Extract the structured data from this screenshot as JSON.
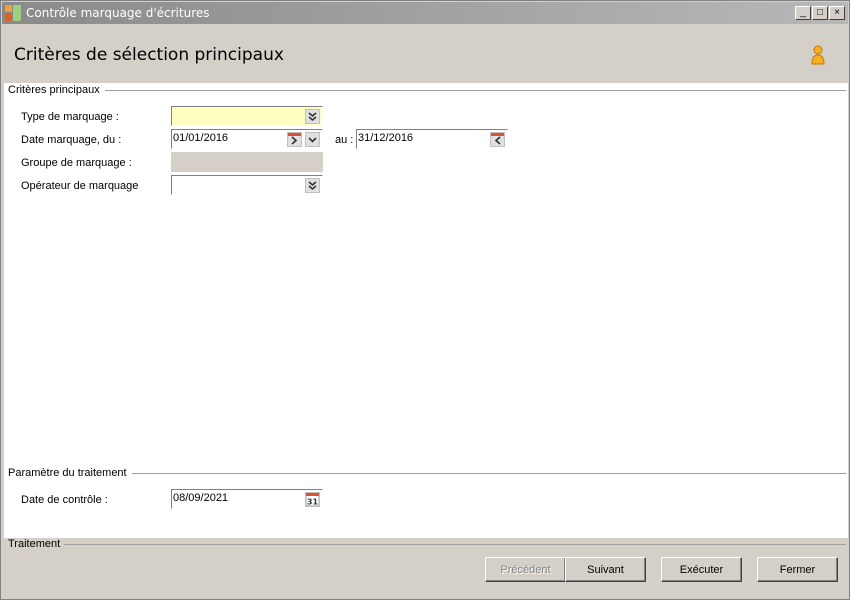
{
  "window": {
    "title": "Contrôle marquage d'écritures",
    "controls": {
      "minimize": "_",
      "maximize": "□",
      "close": "×"
    }
  },
  "header": {
    "title": "Critères de sélection principaux",
    "user_icon": "user-icon"
  },
  "criteria": {
    "section_label": "Critères principaux",
    "type_marquage": {
      "label": "Type de marquage :",
      "value": ""
    },
    "date_marquage": {
      "label": "Date marquage, du :",
      "from": "01/01/2016",
      "to_label": "au :",
      "to": "31/12/2016"
    },
    "groupe_marquage": {
      "label": "Groupe de marquage :",
      "value": ""
    },
    "operateur_marquage": {
      "label": "Opérateur de marquage",
      "value": ""
    }
  },
  "parametres": {
    "section_label": "Paramètre du traitement",
    "date_controle": {
      "label": "Date de contrôle :",
      "value": "08/09/2021"
    }
  },
  "traitement": {
    "section_label": "Traitement",
    "buttons": {
      "precedent": "Précédent",
      "suivant": "Suivant",
      "executer": "Exécuter",
      "fermer": "Fermer"
    }
  },
  "colors": {
    "required_field": "#ffffc0",
    "title_gradient_start": "#8a8a8a",
    "window_bg": "#d4d0c8"
  }
}
